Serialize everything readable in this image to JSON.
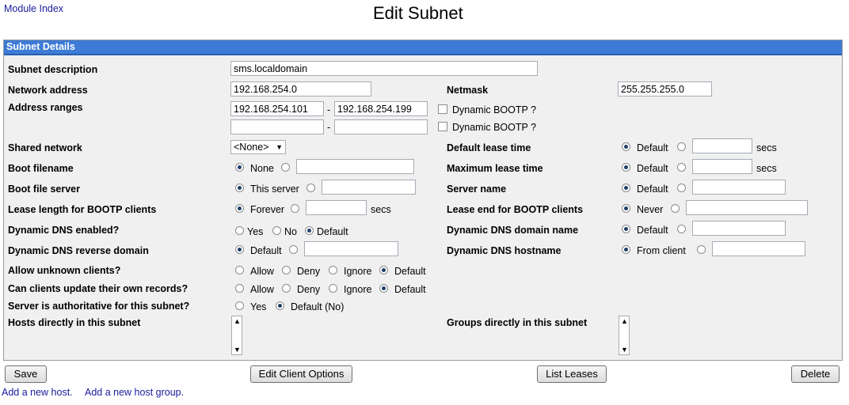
{
  "header": {
    "module_index": "Module Index",
    "title": "Edit Subnet"
  },
  "panel": {
    "title": "Subnet Details"
  },
  "fields": {
    "subnet_description": {
      "label": "Subnet description",
      "value": "sms.localdomain"
    },
    "network_address": {
      "label": "Network address",
      "value": "192.168.254.0"
    },
    "netmask": {
      "label": "Netmask",
      "value": "255.255.255.0"
    },
    "address_ranges": {
      "label": "Address ranges",
      "ranges": [
        {
          "from": "192.168.254.101",
          "to": "192.168.254.199",
          "dynamic_bootp": "Dynamic BOOTP ?",
          "dash": "-"
        },
        {
          "from": "",
          "to": "",
          "dynamic_bootp": "Dynamic BOOTP ?",
          "dash": "-"
        }
      ]
    },
    "shared_network": {
      "label": "Shared network",
      "value": "<None>"
    },
    "default_lease_time": {
      "label": "Default lease time",
      "opt_default": "Default",
      "unit": "secs"
    },
    "boot_filename": {
      "label": "Boot filename",
      "opt_none": "None"
    },
    "maximum_lease_time": {
      "label": "Maximum lease time",
      "opt_default": "Default",
      "unit": "secs"
    },
    "boot_file_server": {
      "label": "Boot file server",
      "opt_this": "This server"
    },
    "server_name": {
      "label": "Server name",
      "opt_default": "Default"
    },
    "lease_length_bootp": {
      "label": "Lease length for BOOTP clients",
      "opt_forever": "Forever",
      "unit": "secs"
    },
    "lease_end_bootp": {
      "label": "Lease end for BOOTP clients",
      "opt_never": "Never"
    },
    "dynamic_dns_enabled": {
      "label": "Dynamic DNS enabled?",
      "opt_yes": "Yes",
      "opt_no": "No",
      "opt_default": "Default"
    },
    "dynamic_dns_domain": {
      "label": "Dynamic DNS domain name",
      "opt_default": "Default"
    },
    "dynamic_dns_reverse": {
      "label": "Dynamic DNS reverse domain",
      "opt_default": "Default"
    },
    "dynamic_dns_hostname": {
      "label": "Dynamic DNS hostname",
      "opt_from_client": "From client"
    },
    "allow_unknown": {
      "label": "Allow unknown clients?",
      "opt_allow": "Allow",
      "opt_deny": "Deny",
      "opt_ignore": "Ignore",
      "opt_default": "Default"
    },
    "clients_update": {
      "label": "Can clients update their own records?",
      "opt_allow": "Allow",
      "opt_deny": "Deny",
      "opt_ignore": "Ignore",
      "opt_default": "Default"
    },
    "authoritative": {
      "label": "Server is authoritative for this subnet?",
      "opt_yes": "Yes",
      "opt_default_no": "Default (No)"
    },
    "hosts_in_subnet": {
      "label": "Hosts directly in this subnet"
    },
    "groups_in_subnet": {
      "label": "Groups directly in this subnet"
    }
  },
  "buttons": {
    "save": "Save",
    "edit_client_options": "Edit Client Options",
    "list_leases": "List Leases",
    "delete": "Delete"
  },
  "footer": {
    "add_host": "Add a new host.",
    "add_host_group": "Add a new host group."
  },
  "colors": {
    "panel_header": "#3d7bd6",
    "panel_bg": "#f0f0f0",
    "link": "#1a1a9c"
  }
}
